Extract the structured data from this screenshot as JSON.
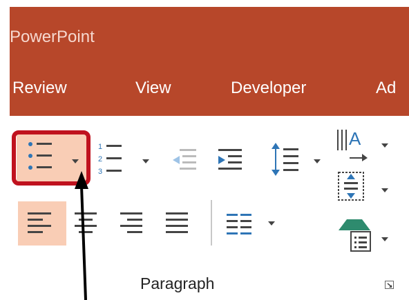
{
  "app": {
    "title": "PowerPoint"
  },
  "tabs": [
    {
      "label": "Review"
    },
    {
      "label": "View"
    },
    {
      "label": "Developer"
    },
    {
      "label": "Ad"
    }
  ],
  "paragraph_group": {
    "label": "Paragraph",
    "buttons": {
      "bullets": "bullets-icon",
      "numbering": "numbering-icon",
      "decrease_indent": "decrease-indent-icon",
      "increase_indent": "increase-indent-icon",
      "line_spacing": "line-spacing-icon",
      "text_direction": "text-direction-icon",
      "align_text": "align-text-icon",
      "convert_smartart": "smartart-icon",
      "align_left": "align-left-icon",
      "center": "align-center-icon",
      "align_right": "align-right-icon",
      "justify": "justify-icon",
      "columns": "columns-icon",
      "dialog_launcher": "dialog-launcher-icon"
    }
  },
  "colors": {
    "accent": "#b7472a",
    "highlight": "#f9cdb5",
    "callout_border": "#c0121e",
    "icon_blue": "#2e75b6"
  }
}
